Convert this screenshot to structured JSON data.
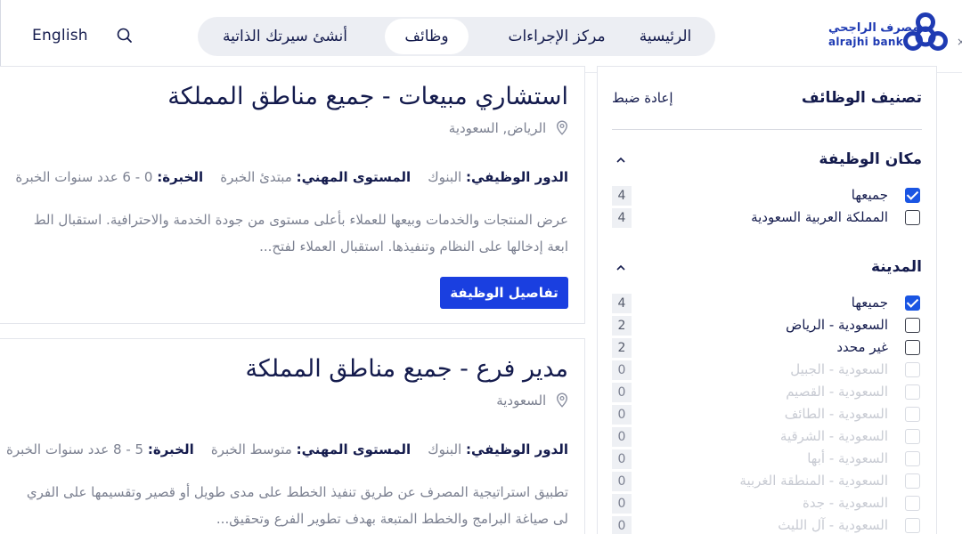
{
  "header": {
    "language": "English",
    "nav": [
      "الرئيسية",
      "مركز الإجراءات",
      "وظائف",
      "أنشئ سيرتك الذاتية"
    ],
    "active_nav": "وظائف",
    "logo_ar": "مصرف الراجحي",
    "logo_en": "alrajhi bank"
  },
  "sidebar": {
    "title": "تصنيف الوظائف",
    "reset": "إعادة ضبط",
    "job_location": {
      "title": "مكان الوظيفة",
      "options": [
        {
          "label": "جميعها",
          "count": "4",
          "checked": true,
          "disabled": false
        },
        {
          "label": "المملكة العربية السعودية",
          "count": "4",
          "checked": false,
          "disabled": false
        }
      ]
    },
    "city": {
      "title": "المدينة",
      "options": [
        {
          "label": "جميعها",
          "count": "4",
          "checked": true,
          "disabled": false
        },
        {
          "label": "السعودية - الرياض",
          "count": "2",
          "checked": false,
          "disabled": false
        },
        {
          "label": "غير محدد",
          "count": "2",
          "checked": false,
          "disabled": false
        },
        {
          "label": "السعودية - الجبيل",
          "count": "0",
          "checked": false,
          "disabled": true
        },
        {
          "label": "السعودية - القصيم",
          "count": "0",
          "checked": false,
          "disabled": true
        },
        {
          "label": "السعودية - الطائف",
          "count": "0",
          "checked": false,
          "disabled": true
        },
        {
          "label": "السعودية - الشرقية",
          "count": "0",
          "checked": false,
          "disabled": true
        },
        {
          "label": "السعودية - أبها",
          "count": "0",
          "checked": false,
          "disabled": true
        },
        {
          "label": "السعودية - المنطقة الغربية",
          "count": "0",
          "checked": false,
          "disabled": true
        },
        {
          "label": "السعودية - جدة",
          "count": "0",
          "checked": false,
          "disabled": true
        },
        {
          "label": "السعودية - آل الليث",
          "count": "0",
          "checked": false,
          "disabled": true
        }
      ]
    }
  },
  "jobs": [
    {
      "title": "استشاري مبيعات - جميع مناطق المملكة",
      "location": "الرياض, السعودية",
      "role_label": "الدور الوظيفي:",
      "role": "البنوك",
      "level_label": "المستوى المهني:",
      "level": "مبتدئ الخبرة",
      "exp_label": "الخبرة:",
      "exp": "0 - 6 عدد سنوات الخبرة",
      "desc_line1": "عرض المنتجات والخدمات وبيعها للعملاء بأعلى مستوى من جودة الخدمة والاحترافية. استقبال الط",
      "desc_line2": "ابعة إدخالها على النظام وتنفيذها. استقبال العملاء لفتح...",
      "button": "تفاصيل الوظيفة"
    },
    {
      "title": "مدير فرع - جميع مناطق المملكة",
      "location": "السعودية",
      "role_label": "الدور الوظيفي:",
      "role": "البنوك",
      "level_label": "المستوى المهني:",
      "level": "متوسط الخبرة",
      "exp_label": "الخبرة:",
      "exp": "5 - 8 عدد سنوات الخبرة",
      "desc_line1": "تطبيق استراتيجية المصرف عن طريق تنفيذ الخطط على مدى طويل أو قصير وتقسيمها على الفري",
      "desc_line2": "لى صياغة البرامج والخطط المتبعة بهدف تطوير الفرع وتحقيق..."
    }
  ]
}
